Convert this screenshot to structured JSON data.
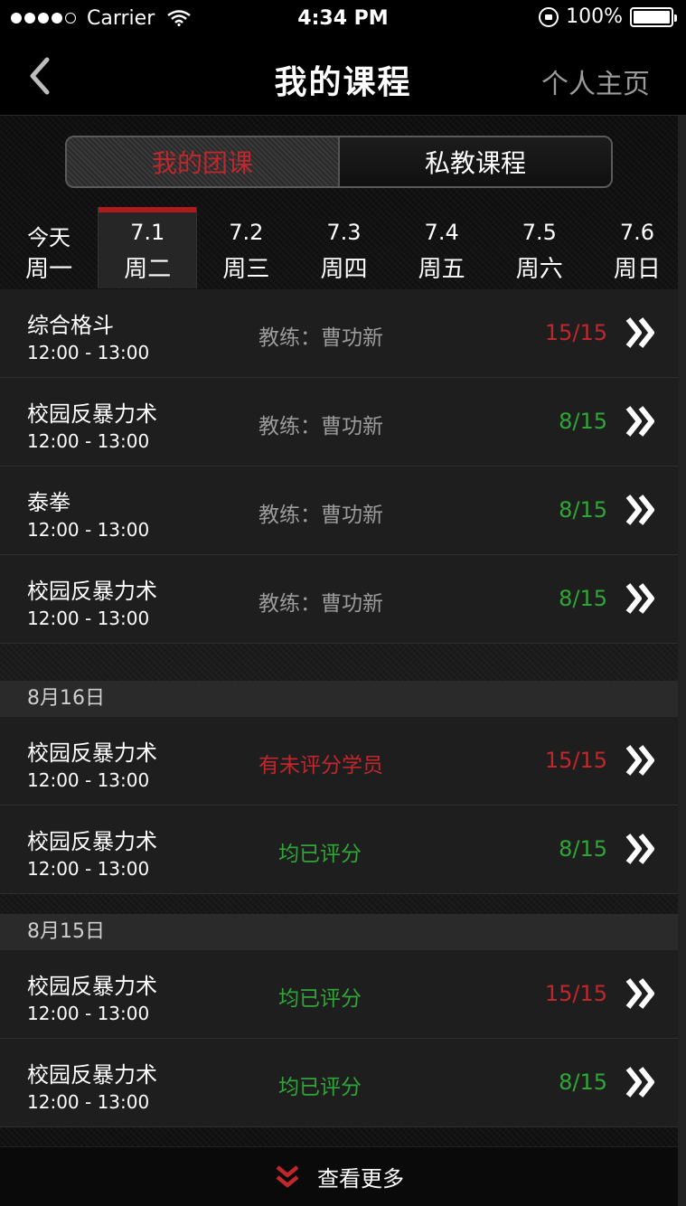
{
  "status": {
    "carrier": "Carrier",
    "time": "4:34 PM",
    "battery": "100%"
  },
  "nav": {
    "title": "我的课程",
    "right": "个人主页"
  },
  "segment": {
    "active": "我的团课",
    "inactive": "私教课程"
  },
  "dates": [
    {
      "d": "今天",
      "w": "周一",
      "active": false
    },
    {
      "d": "7.1",
      "w": "周二",
      "active": true
    },
    {
      "d": "7.2",
      "w": "周三",
      "active": false
    },
    {
      "d": "7.3",
      "w": "周四",
      "active": false
    },
    {
      "d": "7.4",
      "w": "周五",
      "active": false
    },
    {
      "d": "7.5",
      "w": "周六",
      "active": false
    },
    {
      "d": "7.6",
      "w": "周日",
      "active": false
    }
  ],
  "today_rows": [
    {
      "name": "综合格斗",
      "time": "12:00 - 13:00",
      "coach": "教练：曹功新",
      "count": "15/15",
      "count_color": "red"
    },
    {
      "name": "校园反暴力术",
      "time": "12:00 - 13:00",
      "coach": "教练：曹功新",
      "count": "8/15",
      "count_color": "green"
    },
    {
      "name": "泰拳",
      "time": "12:00 - 13:00",
      "coach": "教练：曹功新",
      "count": "8/15",
      "count_color": "green"
    },
    {
      "name": "校园反暴力术",
      "time": "12:00 - 13:00",
      "coach": "教练：曹功新",
      "count": "8/15",
      "count_color": "green"
    }
  ],
  "sections": [
    {
      "date": "8月16日",
      "rows": [
        {
          "name": "校园反暴力术",
          "time": "12:00 - 13:00",
          "status": "有未评分学员",
          "status_color": "red",
          "count": "15/15",
          "count_color": "red"
        },
        {
          "name": "校园反暴力术",
          "time": "12:00 - 13:00",
          "status": "均已评分",
          "status_color": "green",
          "count": "8/15",
          "count_color": "green"
        }
      ]
    },
    {
      "date": "8月15日",
      "rows": [
        {
          "name": "校园反暴力术",
          "time": "12:00 - 13:00",
          "status": "均已评分",
          "status_color": "green",
          "count": "15/15",
          "count_color": "red"
        },
        {
          "name": "校园反暴力术",
          "time": "12:00 - 13:00",
          "status": "均已评分",
          "status_color": "green",
          "count": "8/15",
          "count_color": "green"
        }
      ]
    }
  ],
  "footer": {
    "label": "查看更多"
  },
  "icons": {
    "back": "back-chevron-icon",
    "more": "double-chevron-right-icon",
    "load_more": "double-chevron-down-icon"
  },
  "colors": {
    "accent_red": "#c0272d",
    "green": "#2fa637"
  }
}
